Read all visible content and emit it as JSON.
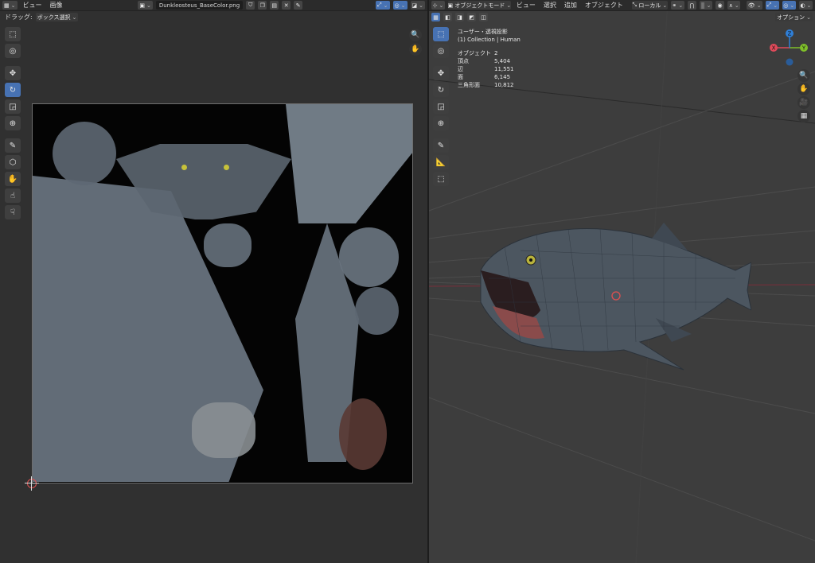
{
  "uv_editor": {
    "header": {
      "menus": [
        "ビュー",
        "画像"
      ],
      "image_name": "Dunkleosteus_BaseColor.png"
    },
    "subheader": {
      "drag_label": "ドラッグ:",
      "drag_value": "ボックス選択"
    }
  },
  "viewport": {
    "header": {
      "mode": "オブジェクトモード",
      "menus": [
        "ビュー",
        "選択",
        "追加",
        "オブジェクト"
      ],
      "orientation": "ローカル",
      "options_label": "オプション"
    },
    "overlay": {
      "view_name": "ユーザー・透視投影",
      "collection": "(1) Collection | Human"
    },
    "stats": [
      {
        "label": "オブジェクト",
        "value": "2"
      },
      {
        "label": "頂点",
        "value": "5,404"
      },
      {
        "label": "辺",
        "value": "11,551"
      },
      {
        "label": "面",
        "value": "6,145"
      },
      {
        "label": "三角形面",
        "value": "10,812"
      }
    ],
    "gizmo": {
      "x": "X",
      "y": "Y",
      "z": "Z"
    }
  },
  "colors": {
    "active": "#4772b3",
    "axis_x": "#e04a5a",
    "axis_y": "#7fbf2a",
    "axis_z": "#2f7fd8"
  }
}
